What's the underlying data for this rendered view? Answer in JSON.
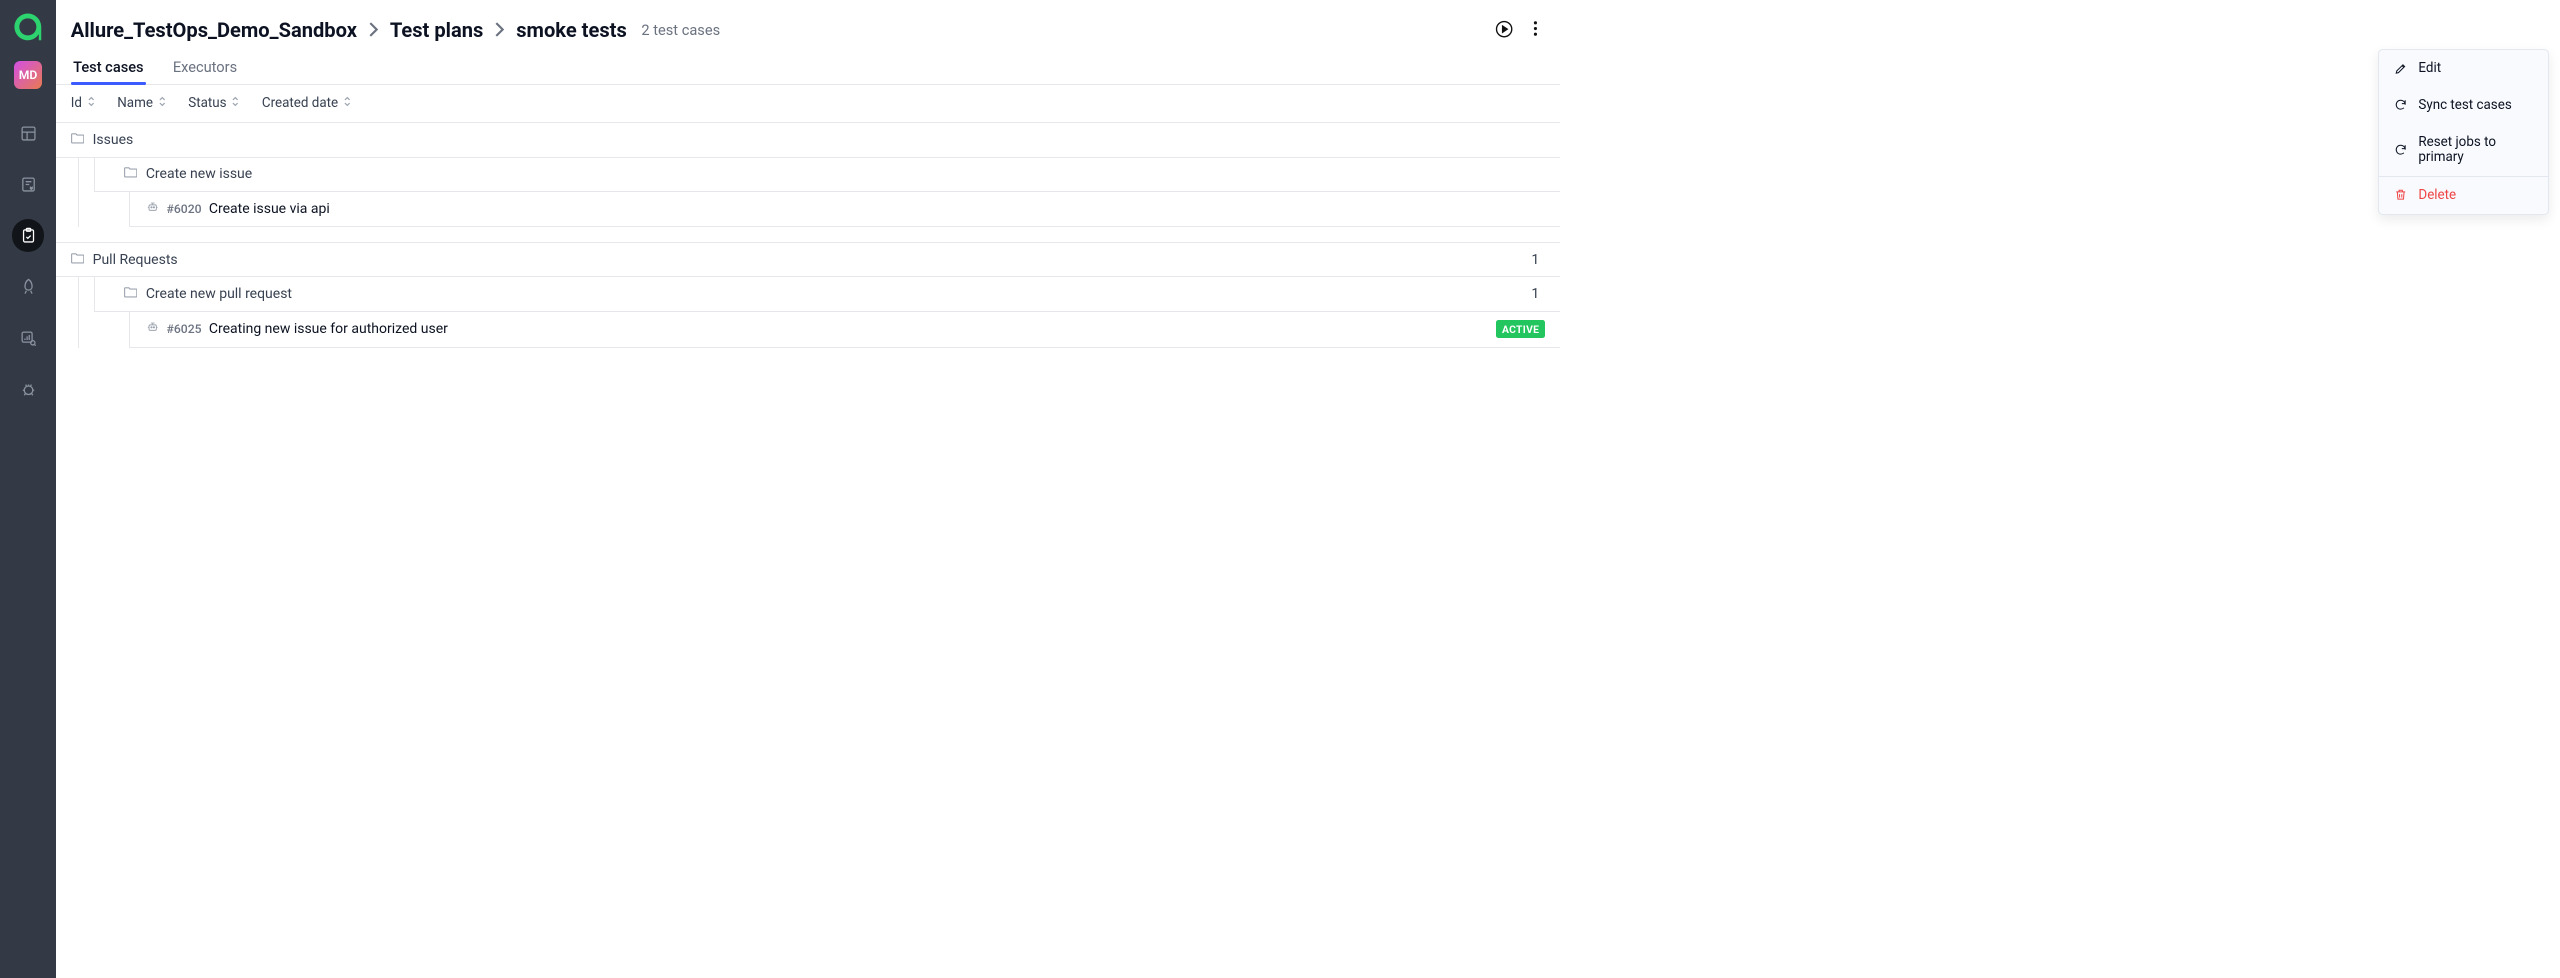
{
  "avatar_initials": "MD",
  "breadcrumb": {
    "project": "Allure_TestOps_Demo_Sandbox",
    "section": "Test plans",
    "item": "smoke tests",
    "count_label": "2 test cases"
  },
  "tabs": {
    "test_cases": "Test cases",
    "executors": "Executors"
  },
  "columns": {
    "id": "Id",
    "name": "Name",
    "status": "Status",
    "created": "Created date"
  },
  "groups": [
    {
      "name": "Issues",
      "count": "",
      "subgroups": [
        {
          "name": "Create new issue",
          "count": "",
          "cases": [
            {
              "id": "#6020",
              "title": "Create issue via api",
              "active": false
            }
          ]
        }
      ]
    },
    {
      "name": "Pull Requests",
      "count": "1",
      "subgroups": [
        {
          "name": "Create new pull request",
          "count": "1",
          "cases": [
            {
              "id": "#6025",
              "title": "Creating new issue for authorized user",
              "active": true
            }
          ]
        }
      ]
    }
  ],
  "active_badge": "ACTIVE",
  "menu": {
    "edit": "Edit",
    "sync": "Sync test cases",
    "reset": "Reset jobs to primary",
    "delete": "Delete"
  }
}
